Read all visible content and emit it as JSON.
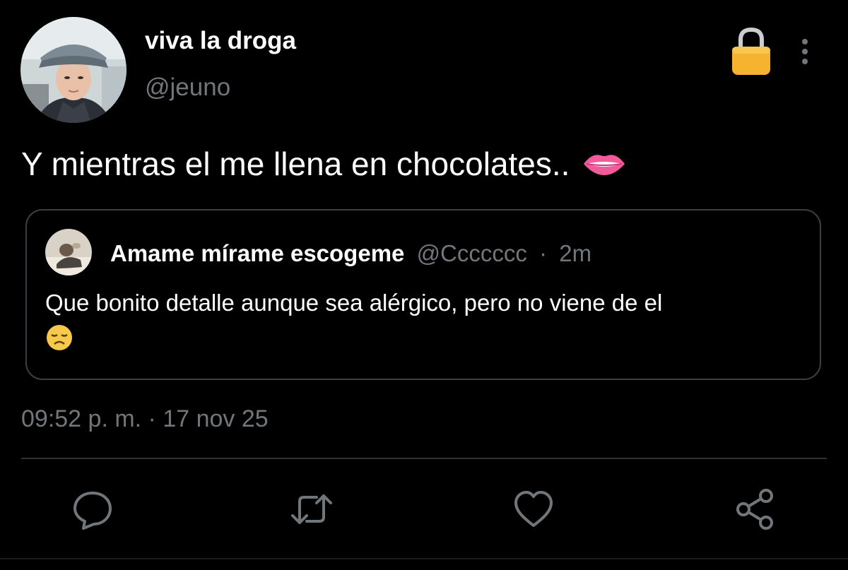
{
  "author": {
    "display_name": "viva la droga",
    "handle": "@jeuno",
    "avatar": "user-photo",
    "protected_icon": "lock-icon"
  },
  "tweet": {
    "text": "Y mientras el me llena en chocolates..",
    "emoji": "lips-icon",
    "timestamp": "09:52 p. m. · 17 nov 25"
  },
  "quote": {
    "display_name": "Amame mírame escogeme",
    "handle": "@Ccccccc",
    "separator": "·",
    "age": "2m",
    "text": "Que bonito detalle aunque sea alérgico, pero no viene de el",
    "emoji": "disappointed-face-icon"
  },
  "actions": [
    "reply-icon",
    "retweet-icon",
    "like-icon",
    "share-icon"
  ],
  "colors": {
    "background": "#000000",
    "primary_text": "#ffffff",
    "secondary_text": "#71767b",
    "border": "#3a3f44",
    "icon": "#71767b"
  }
}
